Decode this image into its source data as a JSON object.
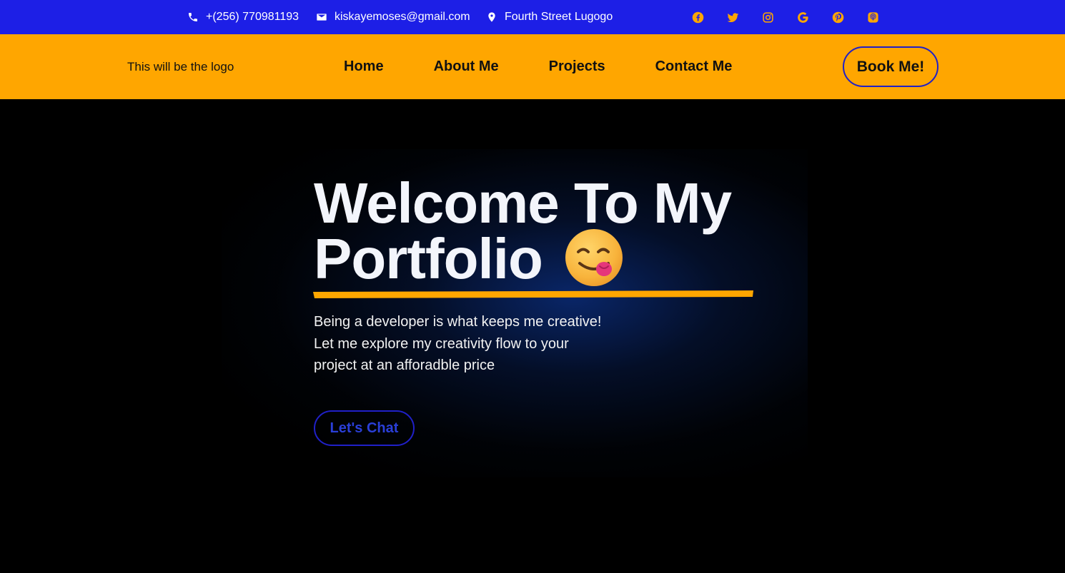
{
  "topbar": {
    "phone": "+(256) 770981193",
    "email": "kiskayemoses@gmail.com",
    "address": "Fourth Street Lugogo",
    "bg_color": "#1d1fe6",
    "icon_color": "#ffa600",
    "socials": [
      "facebook-icon",
      "twitter-icon",
      "instagram-icon",
      "google-icon",
      "pinterest-icon",
      "podcast-icon"
    ]
  },
  "navbar": {
    "logo_text": "This will be the logo",
    "links": [
      "Home",
      "About Me",
      "Projects",
      "Contact Me"
    ],
    "cta_label": "Book Me!",
    "bg_color": "#ffa600"
  },
  "hero": {
    "title_line1": "Welcome To My",
    "title_line2": "Portfolio",
    "emoji": "face-savoring-food-emoji",
    "subtitle_lines": [
      "Being a developer is what keeps me creative!",
      "Let me explore my creativity flow to your",
      "project at an afforadble price"
    ],
    "cta_label": "Let's Chat",
    "accent_color": "#ffa600"
  }
}
